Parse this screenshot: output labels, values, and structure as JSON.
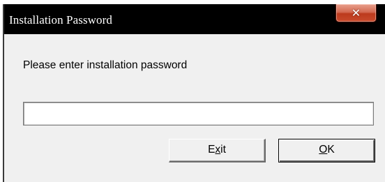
{
  "window": {
    "title": "Installation Password",
    "close_icon": "close-x-icon"
  },
  "dialog": {
    "prompt": "Please enter installation password",
    "password_value": ""
  },
  "buttons": {
    "exit": {
      "pre": "E",
      "mnemonic": "x",
      "post": "it"
    },
    "ok": {
      "pre": "",
      "mnemonic": "O",
      "post": "K"
    }
  },
  "colors": {
    "titlebar": "#000000",
    "close_button": "#c84a2c",
    "dialog_background": "#f0f0f0"
  }
}
